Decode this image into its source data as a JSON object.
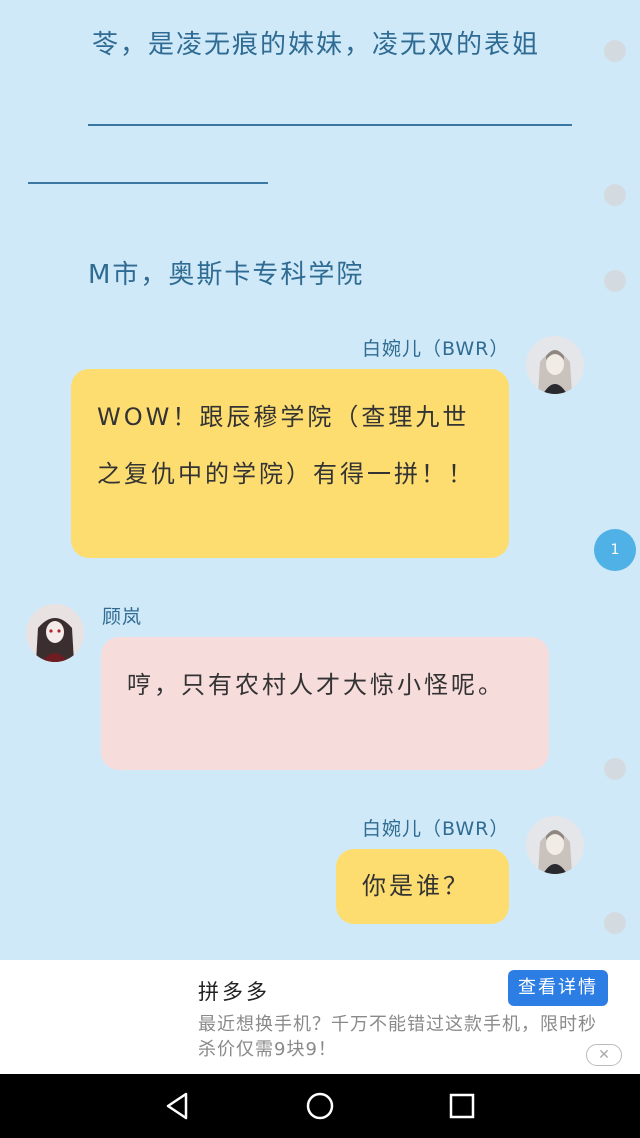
{
  "story": {
    "line1": "苓，是凌无痕的妹妹，凌无双的表姐",
    "line2": "M市，奥斯卡专科学院"
  },
  "messages": [
    {
      "sender": "白婉儿（BWR）",
      "text": "WOW！跟辰穆学院（查理九世之复仇中的学院）有得一拼！！",
      "side": "right",
      "color": "#fddd70"
    },
    {
      "sender": "顾岚",
      "text": "哼，只有农村人才大惊小怪呢。",
      "side": "left",
      "color": "#f7dcdc"
    },
    {
      "sender": "白婉儿（BWR）",
      "text": "你是谁？",
      "side": "right",
      "color": "#fddd70"
    }
  ],
  "page_indicator": "1",
  "ad": {
    "title": "拼多多",
    "body": "最近想换手机？千万不能错过这款手机，限时秒杀价仅需9块9！",
    "button": "查看详情",
    "close": "✕"
  },
  "navbar": {
    "back": "back-icon",
    "home": "home-icon",
    "recents": "recents-icon"
  }
}
